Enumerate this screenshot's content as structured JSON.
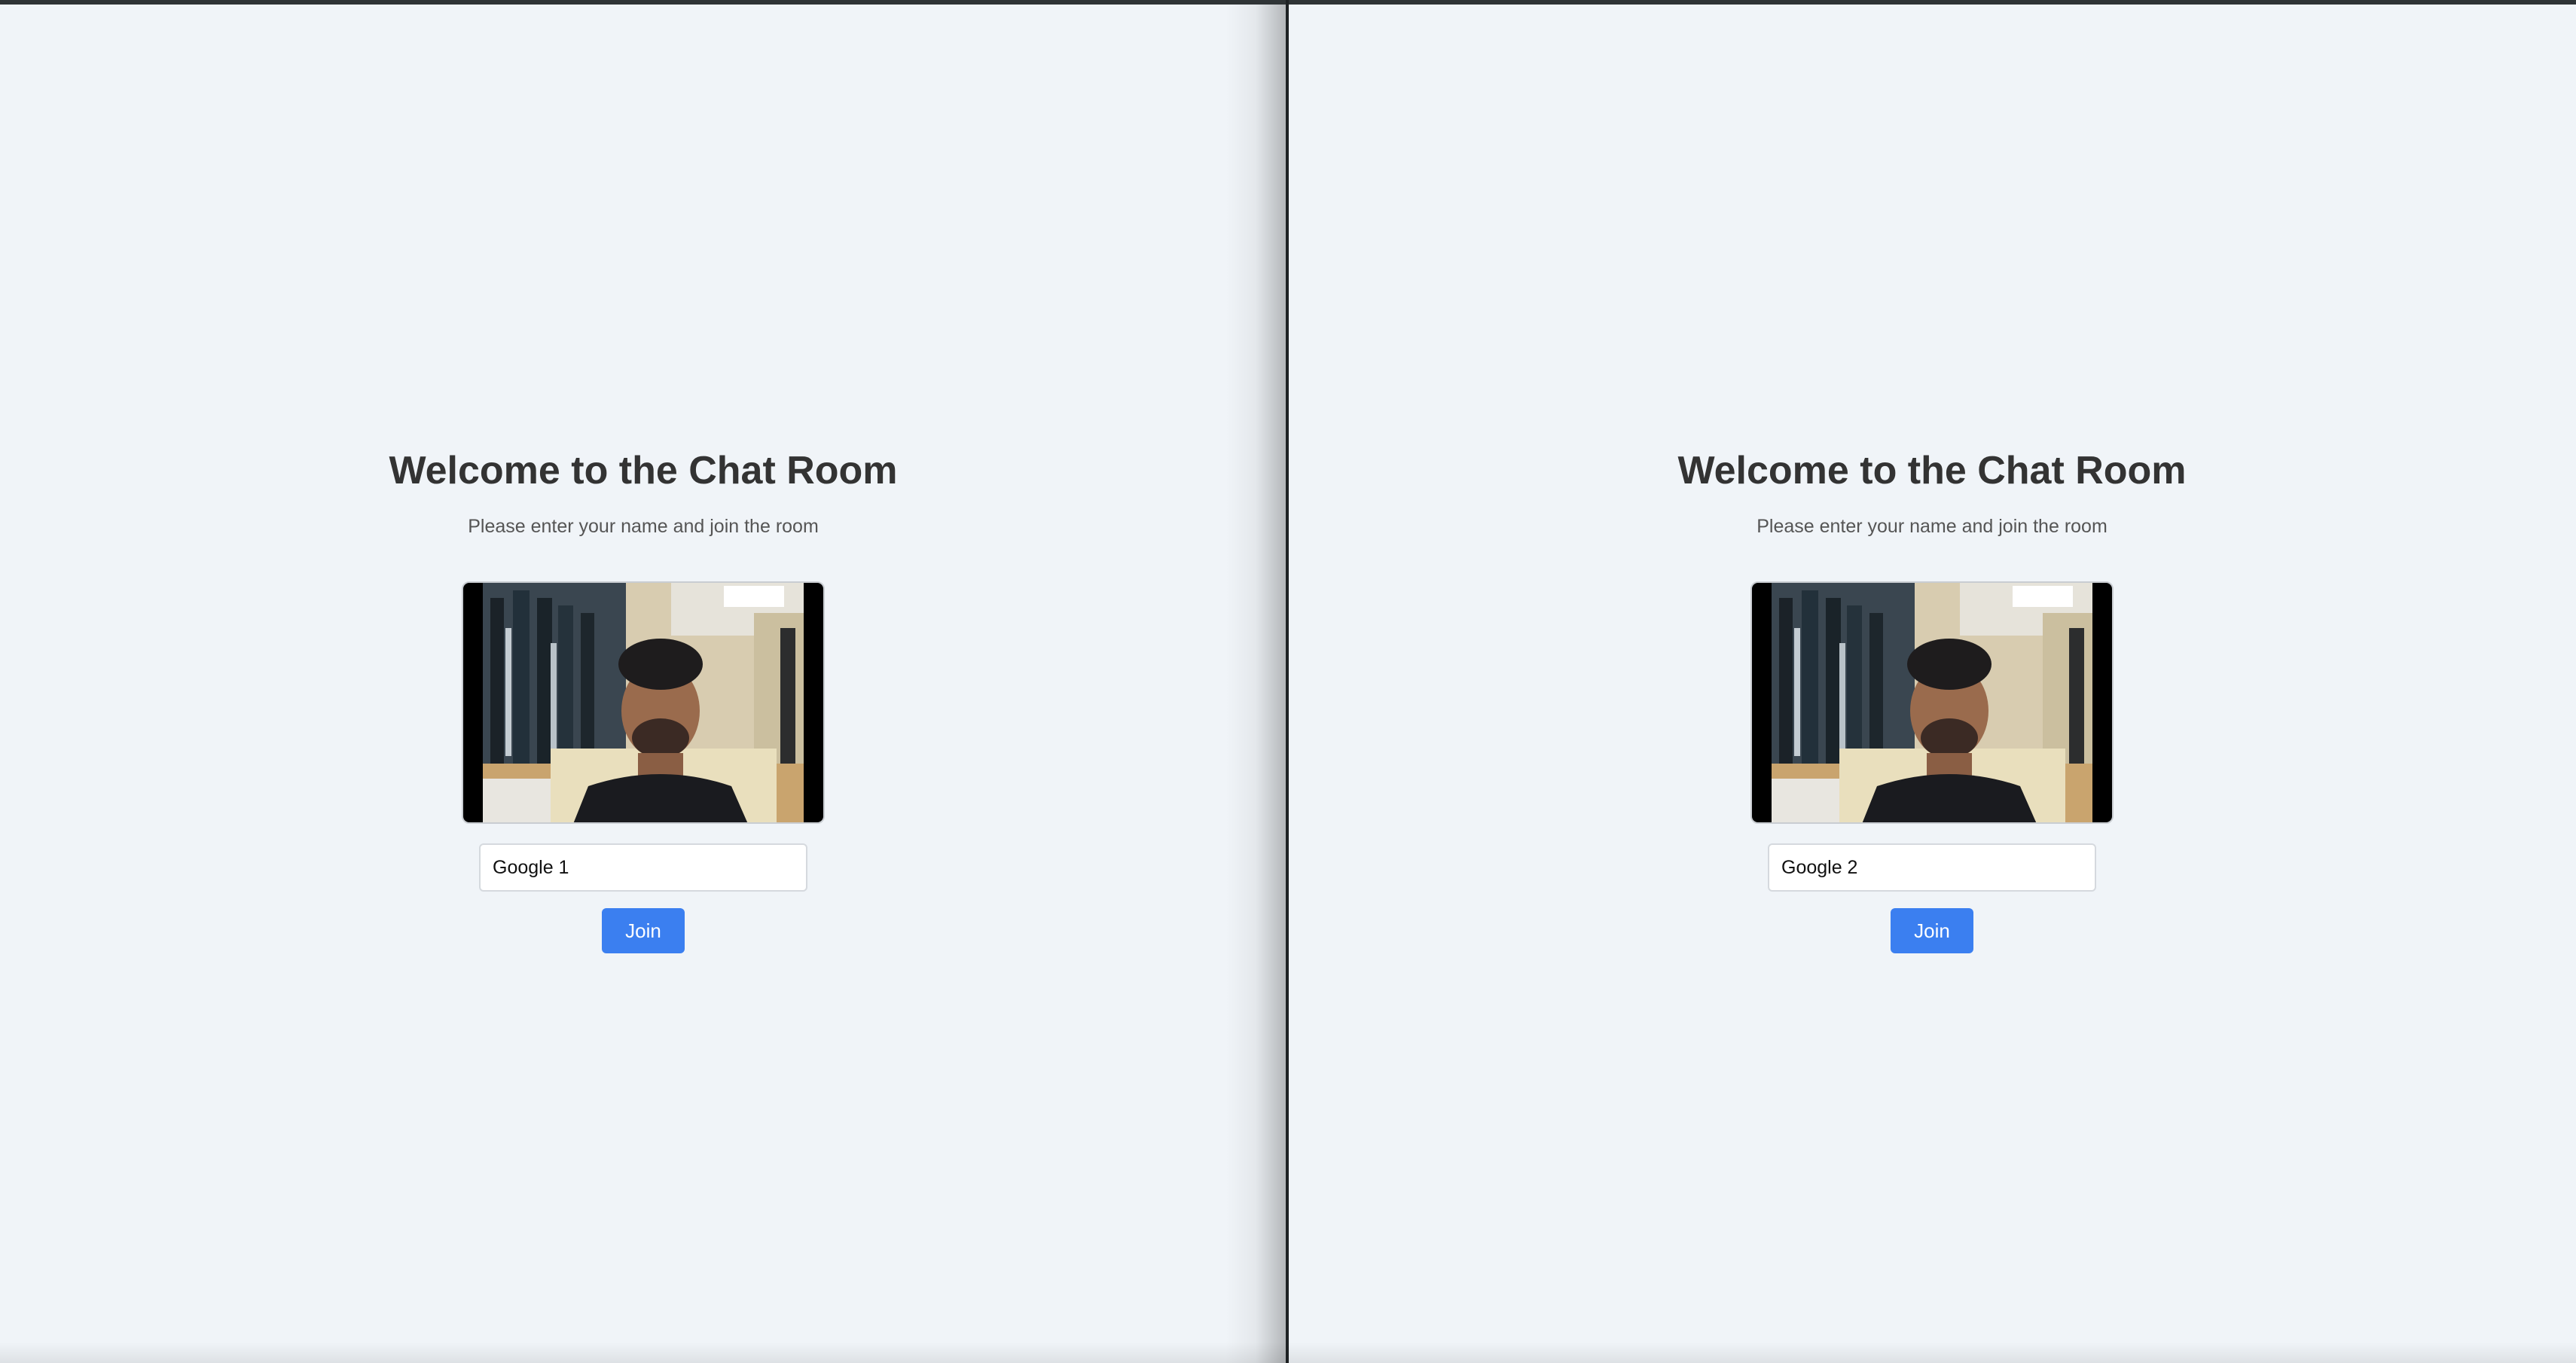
{
  "panes": [
    {
      "title": "Welcome to the Chat Room",
      "subtitle": "Please enter your name and join the room",
      "video_icon": "camera-preview",
      "name_value": "Google 1",
      "join_label": "Join"
    },
    {
      "title": "Welcome to the Chat Room",
      "subtitle": "Please enter your name and join the room",
      "video_icon": "camera-preview",
      "name_value": "Google 2",
      "join_label": "Join"
    }
  ],
  "colors": {
    "background": "#f0f4f8",
    "title": "#333333",
    "subtitle": "#555555",
    "join_button": "#3b7ff0",
    "divider": "#1e2224"
  }
}
